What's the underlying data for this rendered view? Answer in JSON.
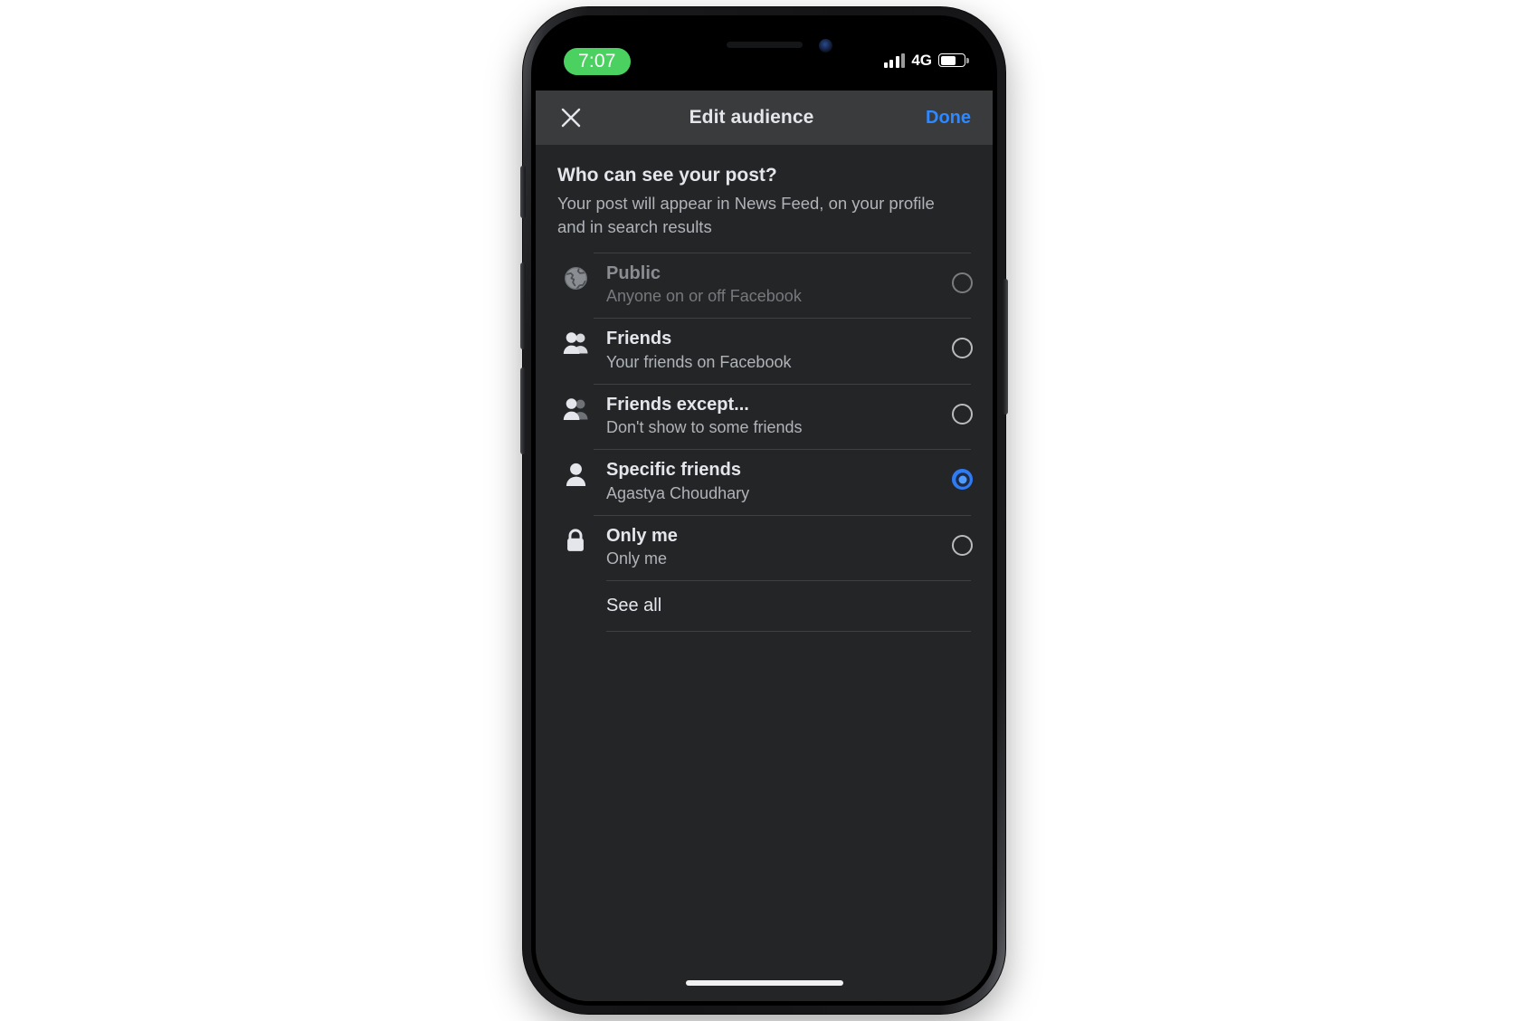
{
  "status_bar": {
    "time": "7:07",
    "network_label": "4G",
    "signal_icon": "cellular-signal-icon",
    "battery_icon": "battery-icon",
    "battery_level_percent": 58,
    "time_pill_color": "#4ad15f"
  },
  "header": {
    "close_icon": "close-x-icon",
    "title": "Edit audience",
    "done_label": "Done",
    "done_color": "#2e88ff"
  },
  "intro": {
    "title": "Who can see your post?",
    "subtitle": "Your post will appear in News Feed, on your profile and in search results"
  },
  "options": [
    {
      "icon": "globe-icon",
      "label": "Public",
      "description": "Anyone on or off Facebook",
      "selected": false,
      "disabled": true
    },
    {
      "icon": "two-people-icon",
      "label": "Friends",
      "description": "Your friends on Facebook",
      "selected": false,
      "disabled": false
    },
    {
      "icon": "friends-except-icon",
      "label": "Friends except...",
      "description": "Don't show to some friends",
      "selected": false,
      "disabled": false
    },
    {
      "icon": "single-person-icon",
      "label": "Specific friends",
      "description": "Agastya Choudhary",
      "selected": true,
      "disabled": false
    },
    {
      "icon": "lock-icon",
      "label": "Only me",
      "description": "Only me",
      "selected": false,
      "disabled": false
    }
  ],
  "see_all": {
    "label": "See all"
  },
  "colors": {
    "accent_blue": "#2e7bf6",
    "header_bg": "#3a3b3c",
    "content_bg": "#242526",
    "primary_text": "#e4e6eb",
    "secondary_text": "#b0b3b8"
  }
}
